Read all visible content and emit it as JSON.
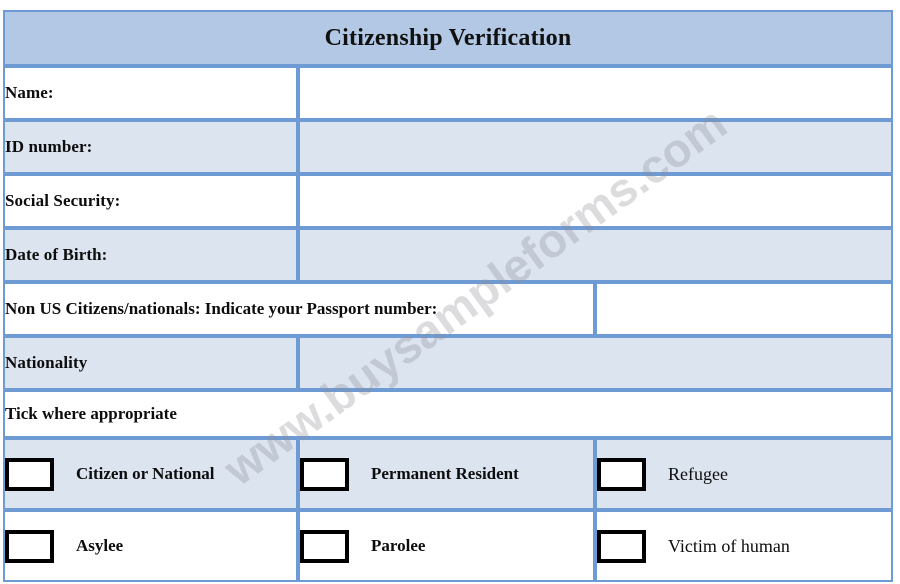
{
  "document": {
    "title": "Citizenship Verification",
    "watermark": "www.buysampleforms.com"
  },
  "colors": {
    "border": "#6f9bd4",
    "header_background": "#b3c8e4",
    "row_alt_background": "#dce4f0",
    "row_background": "#ffffff",
    "text": "#0d0d0d",
    "checkbox_border": "#000000"
  },
  "fields": [
    {
      "label": "Name:",
      "value": ""
    },
    {
      "label": "ID number:",
      "value": ""
    },
    {
      "label": "Social Security:",
      "value": ""
    },
    {
      "label": "Date of Birth:",
      "value": ""
    }
  ],
  "passport_row": {
    "label": "Non US Citizens/nationals: Indicate your Passport number:",
    "value": ""
  },
  "nationality_row": {
    "label": "Nationality",
    "value": ""
  },
  "instruction_row": {
    "label": "Tick where appropriate"
  },
  "status_options": [
    {
      "label": "Citizen or National",
      "checked": false,
      "weight": "bold"
    },
    {
      "label": "Permanent Resident",
      "checked": false,
      "weight": "bold"
    },
    {
      "label": "Refugee",
      "checked": false,
      "weight": "normal"
    },
    {
      "label": "Asylee",
      "checked": false,
      "weight": "bold"
    },
    {
      "label": "Parolee",
      "checked": false,
      "weight": "bold"
    },
    {
      "label": "Victim of human",
      "checked": false,
      "weight": "normal"
    }
  ]
}
